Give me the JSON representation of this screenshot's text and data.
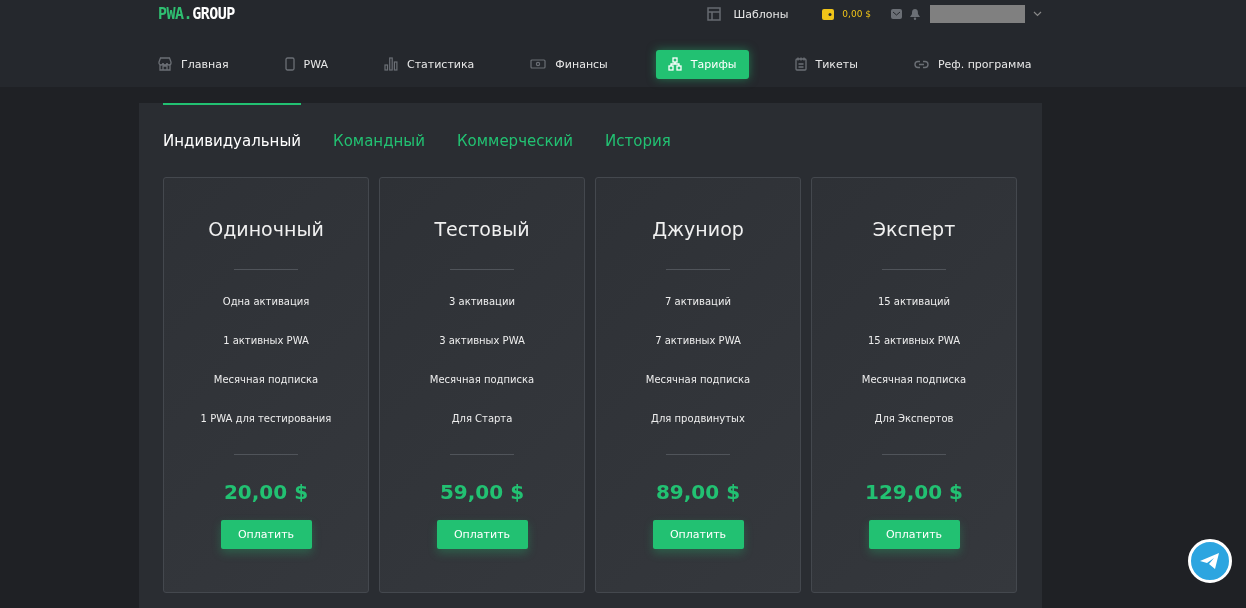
{
  "logo": {
    "accent": "PWA.",
    "main": "GROUP"
  },
  "header": {
    "templates": "Шаблоны",
    "balance": "0,00 $"
  },
  "nav": [
    {
      "label": "Главная",
      "kind": "store",
      "selected": false
    },
    {
      "label": "PWA",
      "kind": "phone",
      "selected": false
    },
    {
      "label": "Статистика",
      "kind": "chart",
      "selected": false
    },
    {
      "label": "Финансы",
      "kind": "cash",
      "selected": false
    },
    {
      "label": "Тарифы",
      "kind": "hierarchy",
      "selected": true
    },
    {
      "label": "Тикеты",
      "kind": "notepad",
      "selected": false
    },
    {
      "label": "Реф. программа",
      "kind": "link",
      "selected": false
    }
  ],
  "tabs": [
    {
      "label": "Индивидуальный",
      "selected": true
    },
    {
      "label": "Командный",
      "selected": false
    },
    {
      "label": "Коммерческий",
      "selected": false
    },
    {
      "label": "История",
      "selected": false
    }
  ],
  "plans": [
    {
      "name": "Одиночный",
      "features": [
        "Одна активация",
        "1 активных PWA",
        "Месячная подписка",
        "1 PWA для тестирования"
      ],
      "price": "20,00 $",
      "button": "Оплатить"
    },
    {
      "name": "Тестовый",
      "features": [
        "3 активации",
        "3 активных PWA",
        "Месячная подписка",
        "Для Старта"
      ],
      "price": "59,00 $",
      "button": "Оплатить"
    },
    {
      "name": "Джуниор",
      "features": [
        "7 активаций",
        "7 активных PWA",
        "Месячная подписка",
        "Для продвинутых"
      ],
      "price": "89,00 $",
      "button": "Оплатить"
    },
    {
      "name": "Эксперт",
      "features": [
        "15 активаций",
        "15 активных PWA",
        "Месячная подписка",
        "Для Экспертов"
      ],
      "price": "129,00 $",
      "button": "Оплатить"
    }
  ]
}
